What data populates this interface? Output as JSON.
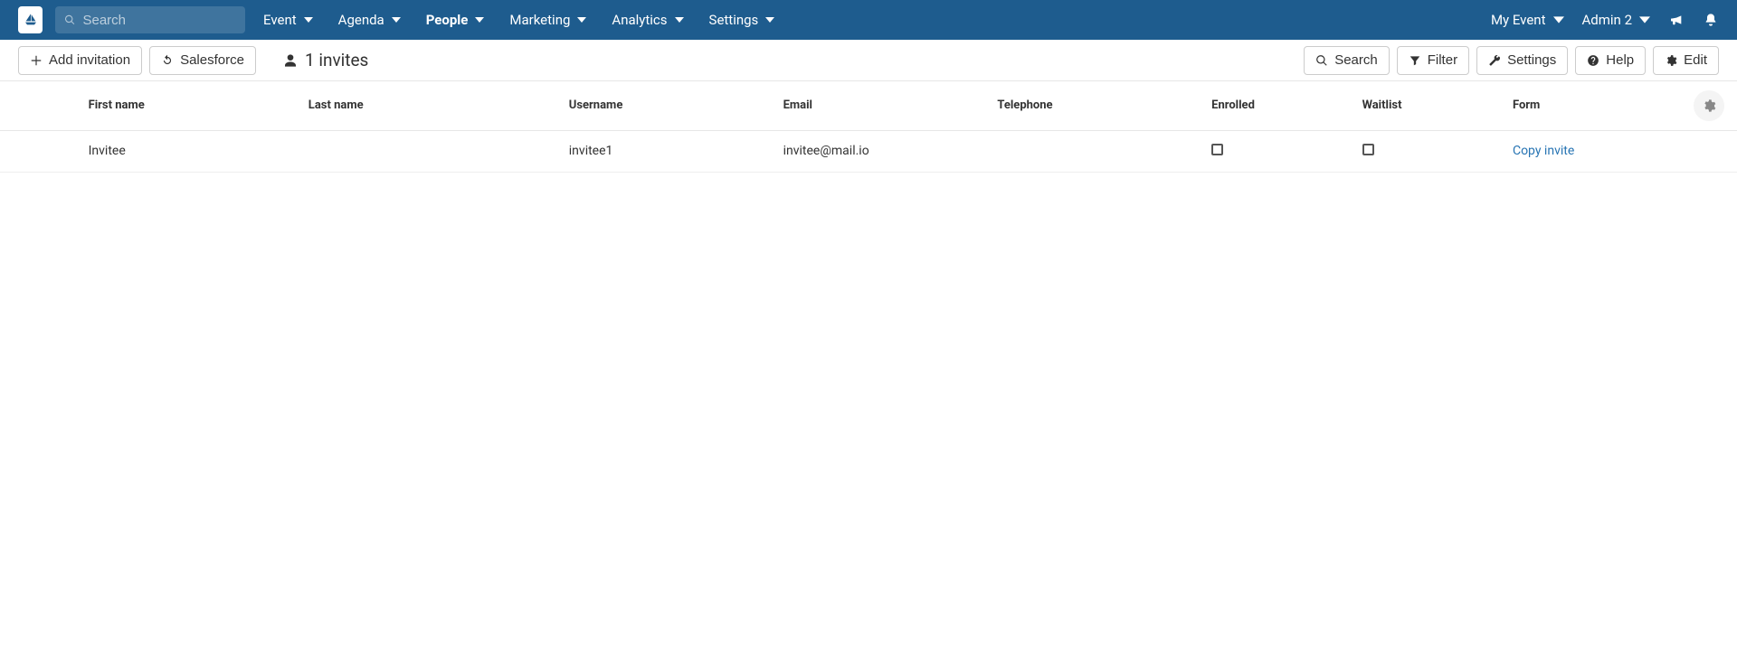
{
  "topbar": {
    "search_placeholder": "Search",
    "nav": [
      {
        "label": "Event",
        "active": false
      },
      {
        "label": "Agenda",
        "active": false
      },
      {
        "label": "People",
        "active": true
      },
      {
        "label": "Marketing",
        "active": false
      },
      {
        "label": "Analytics",
        "active": false
      },
      {
        "label": "Settings",
        "active": false
      }
    ],
    "event_switcher": "My Event",
    "user_menu": "Admin 2"
  },
  "toolbar": {
    "add_invitation": "Add invitation",
    "salesforce": "Salesforce",
    "count_text": "1 invites",
    "search": "Search",
    "filter": "Filter",
    "settings": "Settings",
    "help": "Help",
    "edit": "Edit"
  },
  "table": {
    "columns": {
      "first_name": "First name",
      "last_name": "Last name",
      "username": "Username",
      "email": "Email",
      "telephone": "Telephone",
      "enrolled": "Enrolled",
      "waitlist": "Waitlist",
      "form": "Form"
    },
    "rows": [
      {
        "first_name": "Invitee",
        "last_name": "",
        "username": "invitee1",
        "email": "invitee@mail.io",
        "telephone": "",
        "enrolled": false,
        "waitlist": false,
        "form_action": "Copy invite"
      }
    ]
  }
}
